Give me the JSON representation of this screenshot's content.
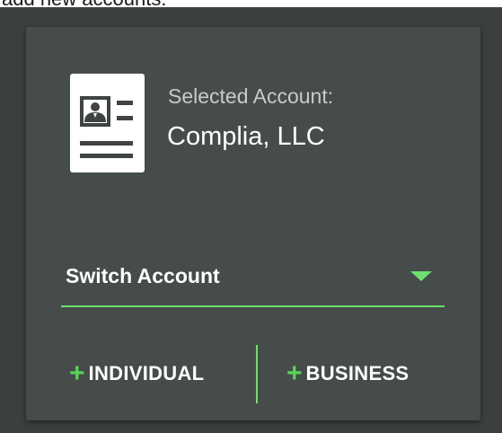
{
  "top_text": "add new accounts.",
  "account": {
    "selected_label": "Selected Account:",
    "selected_name": "Complia, LLC"
  },
  "switch": {
    "label": "Switch Account"
  },
  "actions": {
    "individual_label": "INDIVIDUAL",
    "business_label": "BUSINESS",
    "plus_glyph": "+"
  },
  "icons": {
    "account": "contact-card-icon",
    "dropdown": "caret-down-icon",
    "add": "plus-icon"
  },
  "colors": {
    "accent": "#6fdf6f",
    "card_bg": "#464c4a",
    "page_bg": "#3b3f3e",
    "text_primary": "#ffffff",
    "text_secondary": "#c8cbcb"
  }
}
